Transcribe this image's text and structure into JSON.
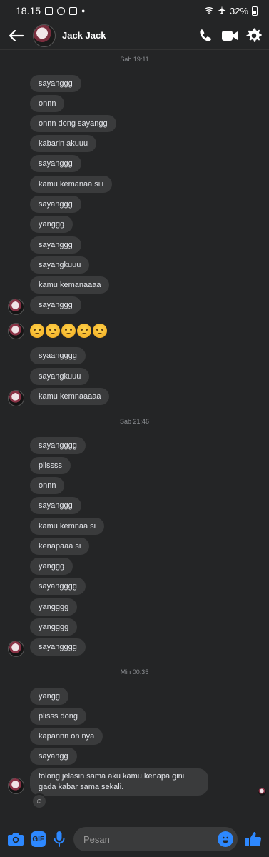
{
  "status_bar": {
    "time": "18.15",
    "battery": "32%"
  },
  "header": {
    "contact_name": "Jack Jack"
  },
  "timestamps": [
    "Sab 19:11",
    "Sab 21:46",
    "Min 00:35"
  ],
  "messages_group1": [
    "sayanggg",
    "onnn",
    "onnn dong sayangg",
    "kabarin akuuu",
    "sayanggg",
    "kamu kemanaa siii",
    "sayanggg",
    "yanggg",
    "sayanggg",
    "sayangkuuu",
    "kamu kemanaaaa",
    "sayanggg"
  ],
  "emoji_message": {
    "icons": [
      "angry-face-icon",
      "angry-face-icon",
      "angry-face-icon",
      "angry-face-icon",
      "angry-face-icon"
    ]
  },
  "messages_group2": [
    "syaangggg",
    "sayangkuuu",
    "kamu kemnaaaaa"
  ],
  "messages_group3": [
    "sayangggg",
    "plissss",
    "onnn",
    "sayanggg",
    "kamu kemnaa si",
    "kenapaaa si",
    "yanggg",
    "sayangggg",
    "yangggg",
    "yangggg",
    "sayangggg"
  ],
  "messages_group4": [
    "yangg",
    "plisss dong",
    "kapannn on nya",
    "sayangg",
    "tolong jelasin sama aku kamu kenapa gini gada kabar sama sekali."
  ],
  "composer": {
    "placeholder": "Pesan"
  }
}
